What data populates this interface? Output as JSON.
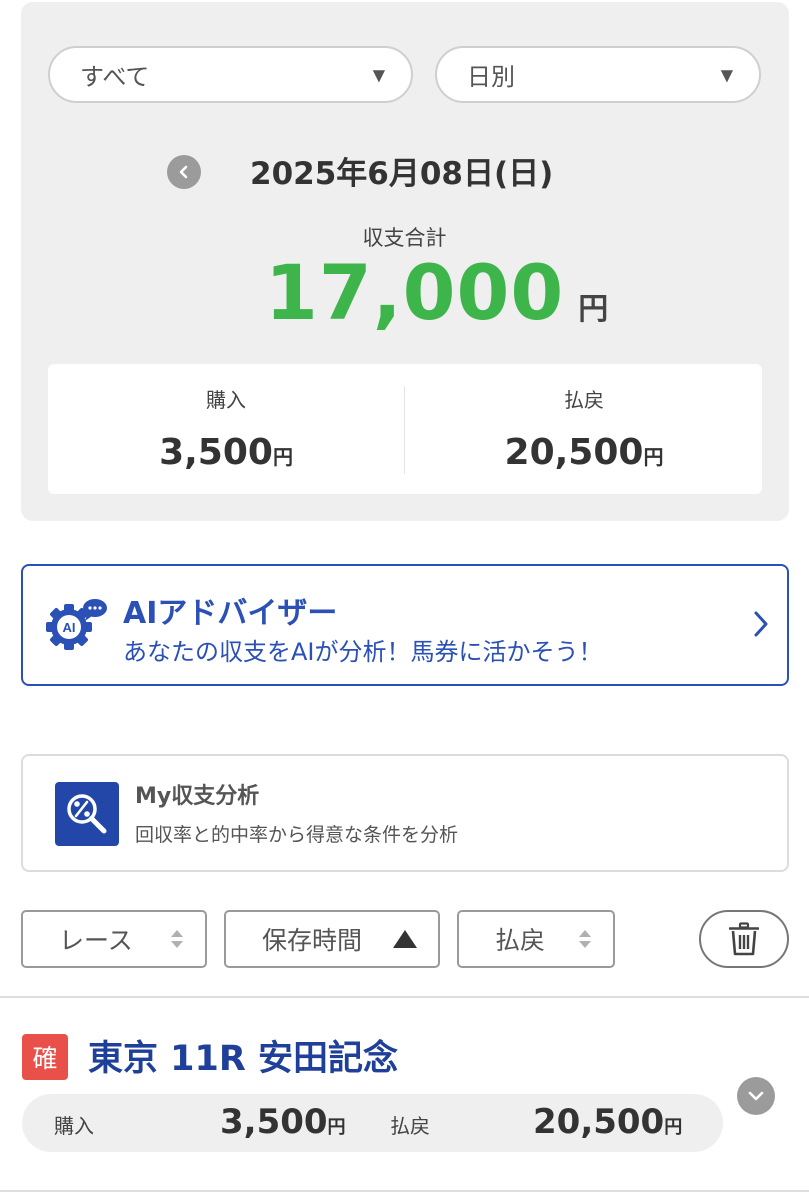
{
  "filters": {
    "category": "すべて",
    "period": "日別"
  },
  "date_nav": {
    "date": "2025年6月08日(日)"
  },
  "summary": {
    "caption": "収支合計",
    "total": "17,000",
    "unit": "円",
    "purchase_label": "購入",
    "purchase_value": "3,500",
    "payout_label": "払戻",
    "payout_value": "20,500",
    "total_color": "#3db54a"
  },
  "ai_banner": {
    "title": "AIアドバイザー",
    "description": "あなたの収支をAIが分析！馬券に活かそう！",
    "icon_text": "AI",
    "accent_color": "#2b50b6"
  },
  "my_analysis": {
    "title": "My収支分析",
    "description": "回収率と的中率から得意な条件を分析"
  },
  "sort_bar": {
    "race_label": "レース",
    "time_label": "保存時間",
    "payout_label": "払戻"
  },
  "race_entry": {
    "badge": "確",
    "title": "東京 11R 安田記念",
    "purchase_label": "購入",
    "purchase_value": "3,500",
    "payout_label": "払戻",
    "payout_value": "20,500",
    "unit": "円"
  }
}
